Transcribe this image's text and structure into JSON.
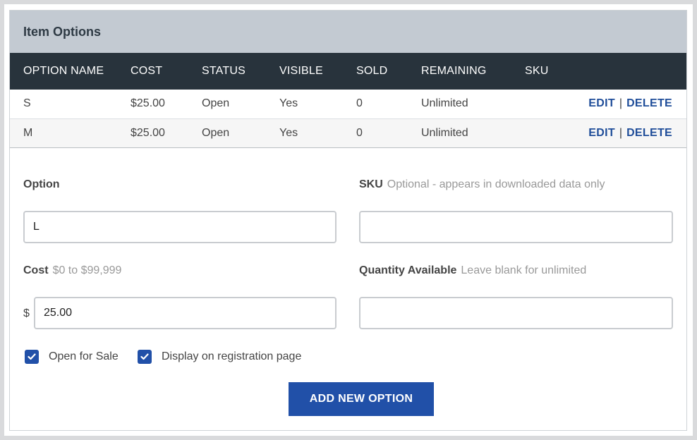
{
  "panel": {
    "title": "Item Options"
  },
  "table": {
    "headers": [
      "OPTION NAME",
      "COST",
      "STATUS",
      "VISIBLE",
      "SOLD",
      "REMAINING",
      "SKU"
    ],
    "rows": [
      {
        "name": "S",
        "cost": "$25.00",
        "status": "Open",
        "visible": "Yes",
        "sold": "0",
        "remaining": "Unlimited",
        "sku": ""
      },
      {
        "name": "M",
        "cost": "$25.00",
        "status": "Open",
        "visible": "Yes",
        "sold": "0",
        "remaining": "Unlimited",
        "sku": ""
      }
    ],
    "edit_label": "EDIT",
    "separator": "|",
    "delete_label": "DELETE"
  },
  "form": {
    "option": {
      "label": "Option",
      "value": "L"
    },
    "sku": {
      "label": "SKU",
      "hint": "Optional - appears in downloaded data only",
      "value": ""
    },
    "cost": {
      "label": "Cost",
      "hint": "$0 to $99,999",
      "currency": "$",
      "value": "25.00"
    },
    "quantity": {
      "label": "Quantity Available",
      "hint": "Leave blank for unlimited",
      "value": ""
    },
    "open_for_sale": {
      "label": "Open for Sale",
      "checked": true
    },
    "display_on_page": {
      "label": "Display on registration page",
      "checked": true
    },
    "submit_label": "ADD NEW OPTION"
  },
  "colors": {
    "accent": "#2150a8",
    "header_bg": "#28333c",
    "panel_header_bg": "#c3cad2"
  },
  "icons": {
    "checkbox": "checkmark-icon"
  }
}
